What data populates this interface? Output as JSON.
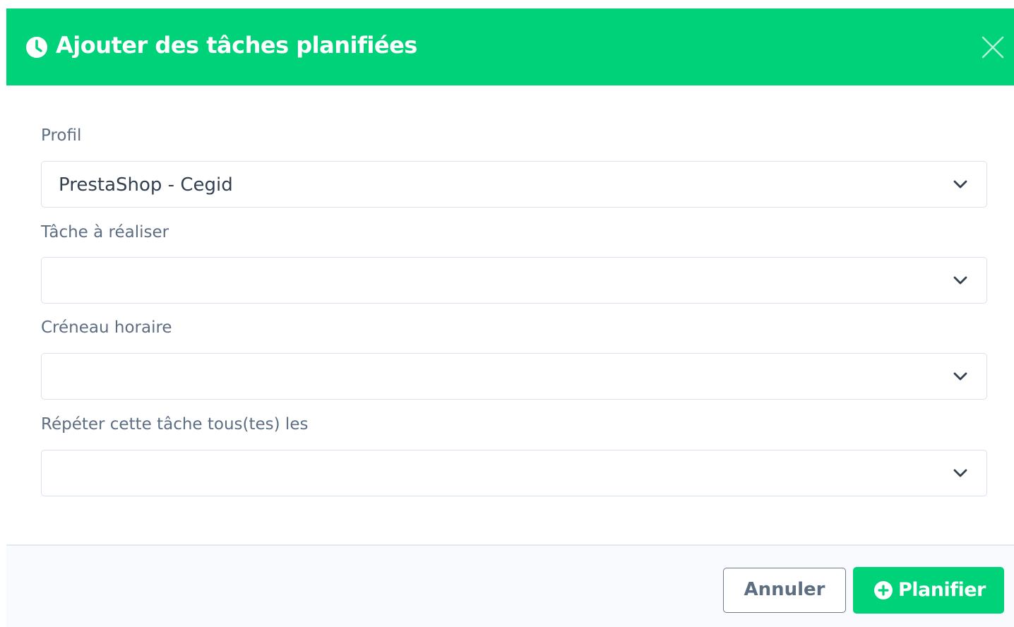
{
  "modal": {
    "title": "Ajouter des tâches planifiées",
    "header_icon": "clock-icon",
    "close_icon": "close-icon",
    "accent_color": "#00d27a"
  },
  "form": {
    "fields": [
      {
        "label": "Profil",
        "value": "PrestaShop - Cegid"
      },
      {
        "label": "Tâche à réaliser",
        "value": ""
      },
      {
        "label": "Créneau horaire",
        "value": ""
      },
      {
        "label": "Répéter cette tâche tous(tes) les",
        "value": ""
      }
    ]
  },
  "footer": {
    "cancel_label": "Annuler",
    "submit_label": "Planifier",
    "submit_icon": "plus-circle-icon"
  }
}
